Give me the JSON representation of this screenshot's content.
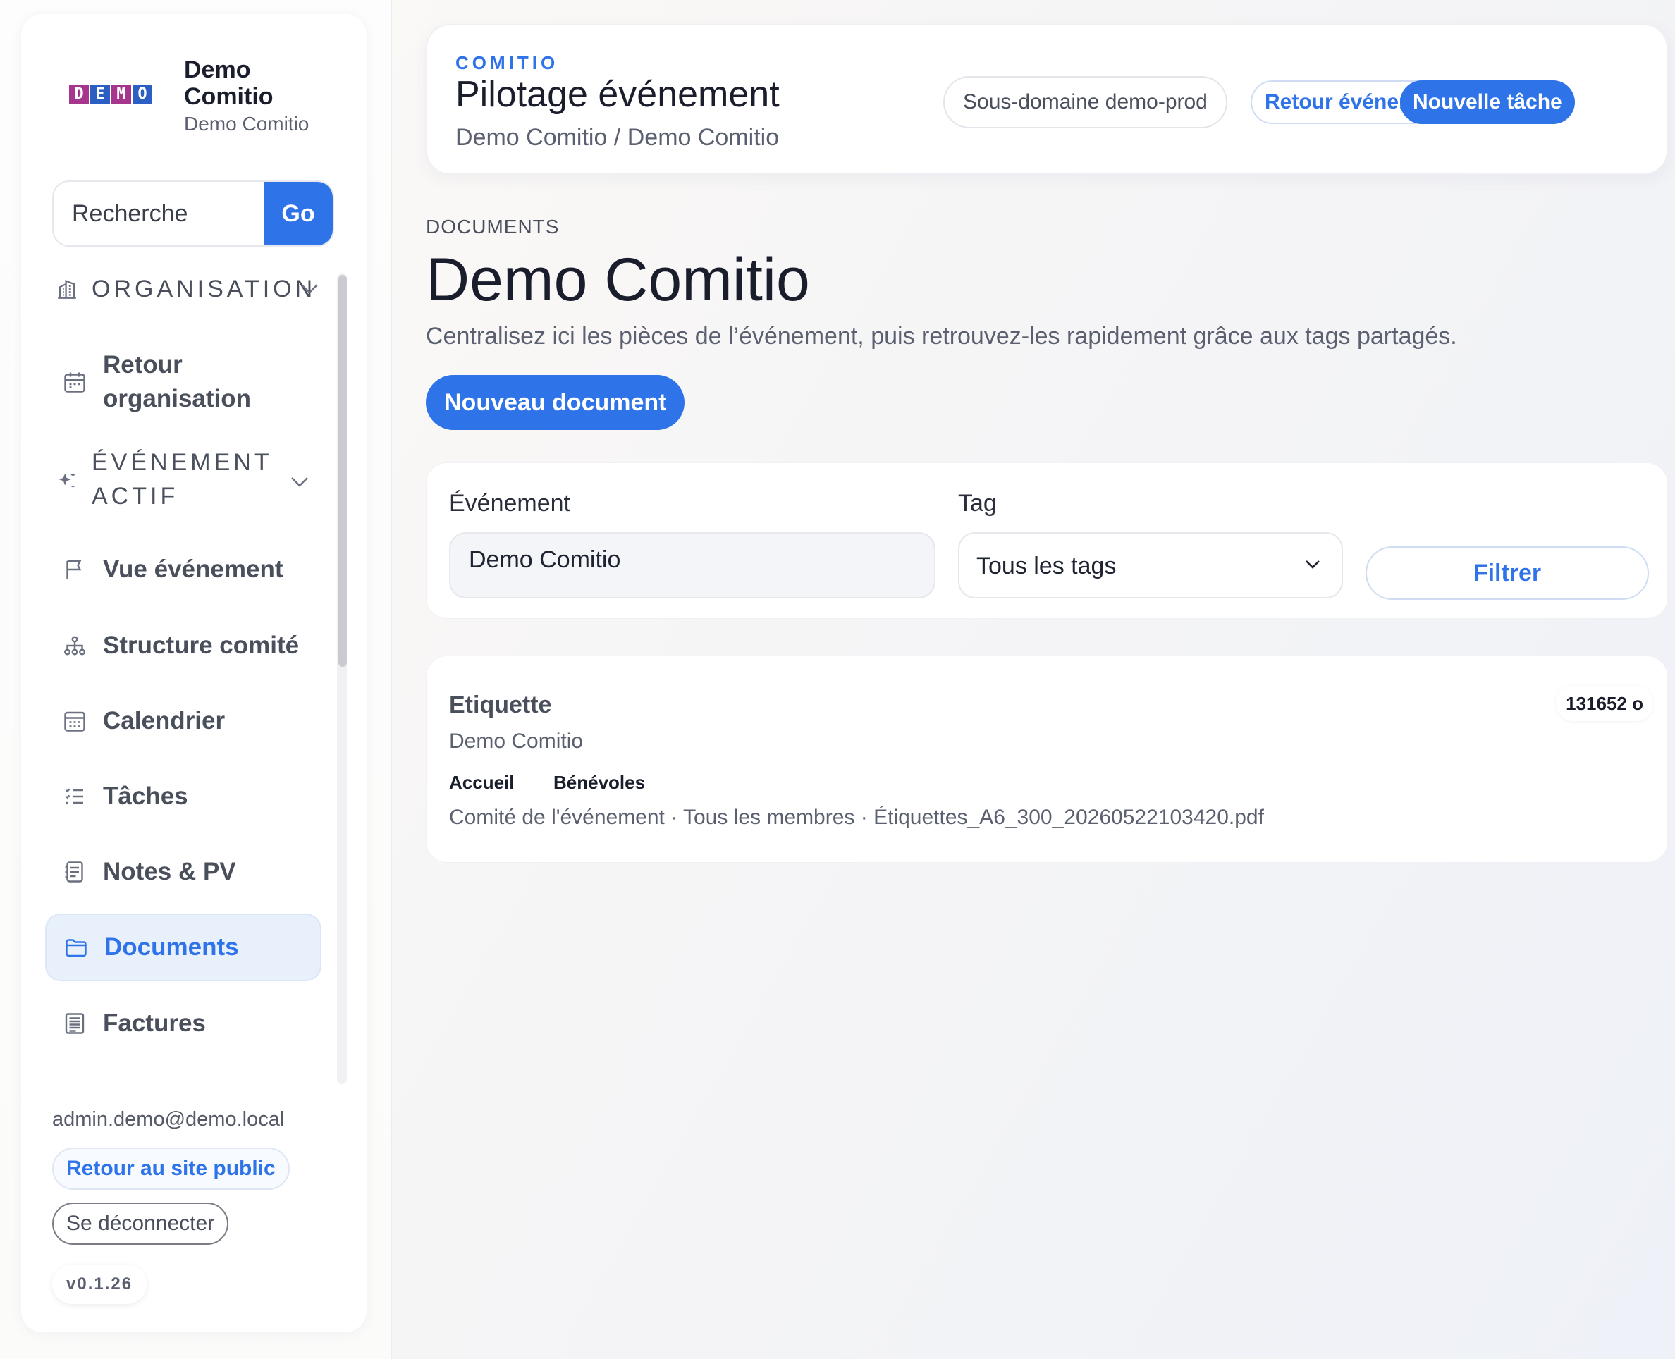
{
  "sidebar": {
    "logo_letters": [
      "D",
      "E",
      "M",
      "O"
    ],
    "logo_colors": [
      "#a5358d",
      "#2c5fc4",
      "#a5358d",
      "#2c5fc4"
    ],
    "org_name": "Demo Comitio",
    "org_sub": "Demo Comitio",
    "search": {
      "placeholder": "Recherche",
      "button": "Go"
    },
    "section_org": "ORGANISATION",
    "org_items": [
      {
        "label": "Retour organisation",
        "icon": "calendar-grid-icon"
      }
    ],
    "section_event": "ÉVÉNEMENT ACTIF",
    "event_items": [
      {
        "label": "Vue événement",
        "icon": "flag-icon"
      },
      {
        "label": "Structure comité",
        "icon": "org-chart-icon"
      },
      {
        "label": "Calendrier",
        "icon": "calendar-icon"
      },
      {
        "label": "Tâches",
        "icon": "checklist-icon"
      },
      {
        "label": "Notes & PV",
        "icon": "notes-icon"
      },
      {
        "label": "Documents",
        "icon": "folder-icon",
        "active": true
      },
      {
        "label": "Factures",
        "icon": "invoice-icon"
      }
    ],
    "user_email": "admin.demo@demo.local",
    "public_link": "Retour au site public",
    "logout": "Se déconnecter",
    "version": "v0.1.26"
  },
  "header": {
    "eyebrow": "COMITIO",
    "title": "Pilotage événement",
    "breadcrumb": "Demo Comitio / Demo Comitio",
    "subdomain_button": "Sous-domaine demo-prod",
    "back_events_button": "Retour événements",
    "new_task_button": "Nouvelle tâche"
  },
  "main": {
    "eyebrow": "DOCUMENTS",
    "title": "Demo Comitio",
    "description": "Centralisez ici les pièces de l’événement, puis retrouvez-les rapidement grâce aux tags partagés.",
    "new_document_button": "Nouveau document",
    "filters": {
      "event_label": "Événement",
      "event_value": "Demo Comitio",
      "tag_label": "Tag",
      "tag_value": "Tous les tags",
      "filter_button": "Filtrer"
    },
    "documents": [
      {
        "name": "Etiquette",
        "event": "Demo Comitio",
        "size": "131652 o",
        "tags": [
          "Accueil",
          "Bénévoles"
        ],
        "meta": "Comité de l'événement · Tous les membres · Étiquettes_A6_300_20260522103420.pdf"
      }
    ]
  },
  "colors": {
    "accent": "#2f73e9",
    "active_bg": "#e8f0fc"
  }
}
